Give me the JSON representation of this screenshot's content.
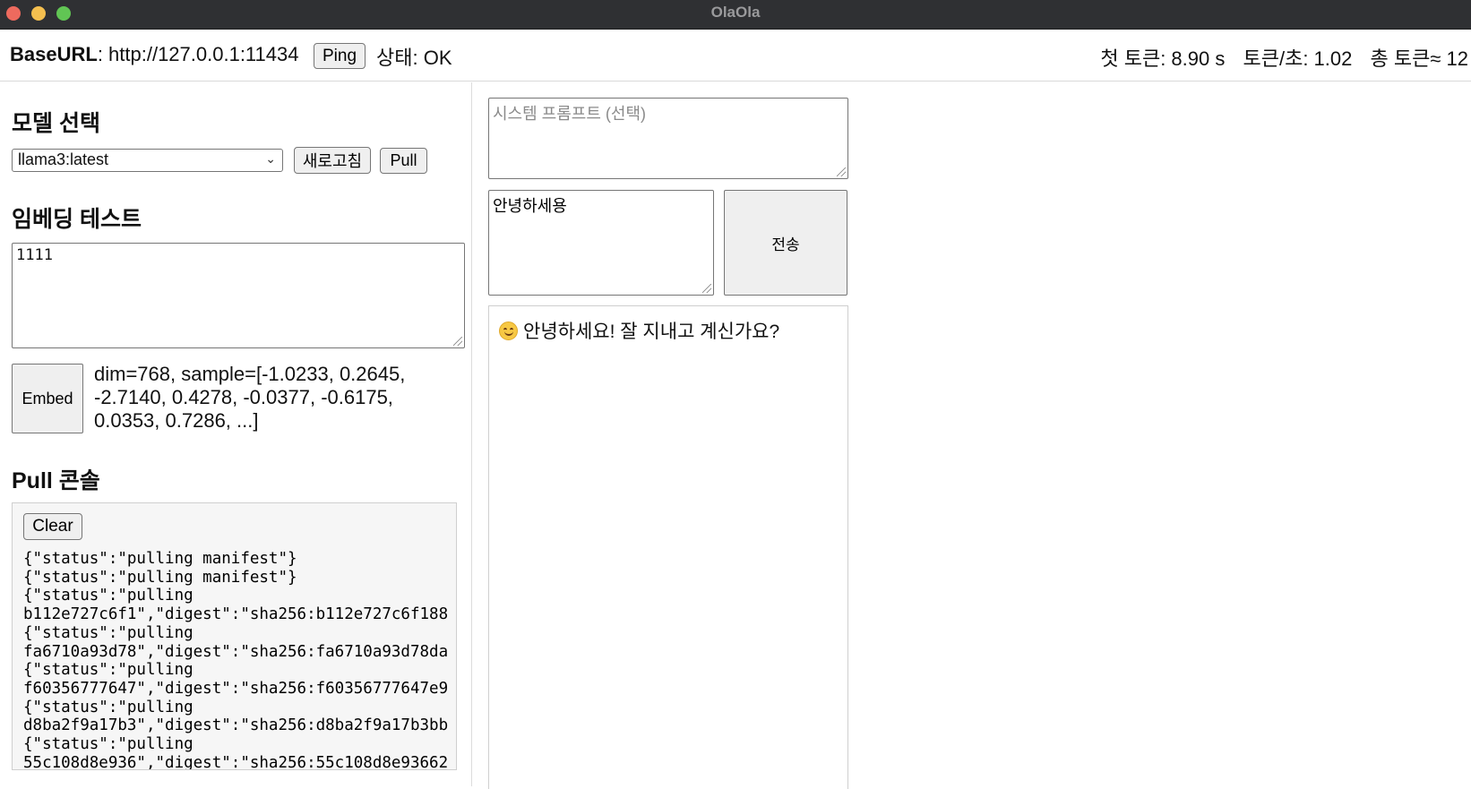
{
  "window": {
    "title": "OlaOla"
  },
  "header": {
    "baseurl_label": "BaseURL",
    "baseurl_value": ": http://127.0.0.1:11434",
    "ping_label": "Ping",
    "status_text": "상태: OK",
    "first_token": "첫 토큰: 8.90 s",
    "tokens_per_sec": "토큰/초: 1.02",
    "total_tokens": "총 토큰≈ 12"
  },
  "model": {
    "heading": "모델 선택",
    "selected": "llama3:latest",
    "refresh_label": "새로고침",
    "pull_label": "Pull"
  },
  "embedding": {
    "heading": "임베딩 테스트",
    "input_value": "1111",
    "button_label": "Embed",
    "result": "dim=768, sample=[-1.0233, 0.2645, -2.7140, 0.4278, -0.0377, -0.6175, 0.0353, 0.7286, ...]"
  },
  "pull_console": {
    "heading": "Pull 콘솔",
    "clear_label": "Clear",
    "lines": [
      "{\"status\":\"pulling manifest\"}",
      "{\"status\":\"pulling manifest\"}",
      "{\"status\":\"pulling",
      "b112e727c6f1\",\"digest\":\"sha256:b112e727c6f188",
      "{\"status\":\"pulling",
      "fa6710a93d78\",\"digest\":\"sha256:fa6710a93d78da",
      "{\"status\":\"pulling",
      "f60356777647\",\"digest\":\"sha256:f60356777647e9",
      "{\"status\":\"pulling",
      "d8ba2f9a17b3\",\"digest\":\"sha256:d8ba2f9a17b3bb",
      "{\"status\":\"pulling",
      "55c108d8e936\",\"digest\":\"sha256:55c108d8e93662"
    ]
  },
  "chat": {
    "system_prompt_placeholder": "시스템 프롬프트 (선택)",
    "message_value": "안녕하세용",
    "send_label": "전송",
    "response_icon": "smile-emoji",
    "response_text": "안녕하세요! 잘 지내고 계신가요?"
  }
}
